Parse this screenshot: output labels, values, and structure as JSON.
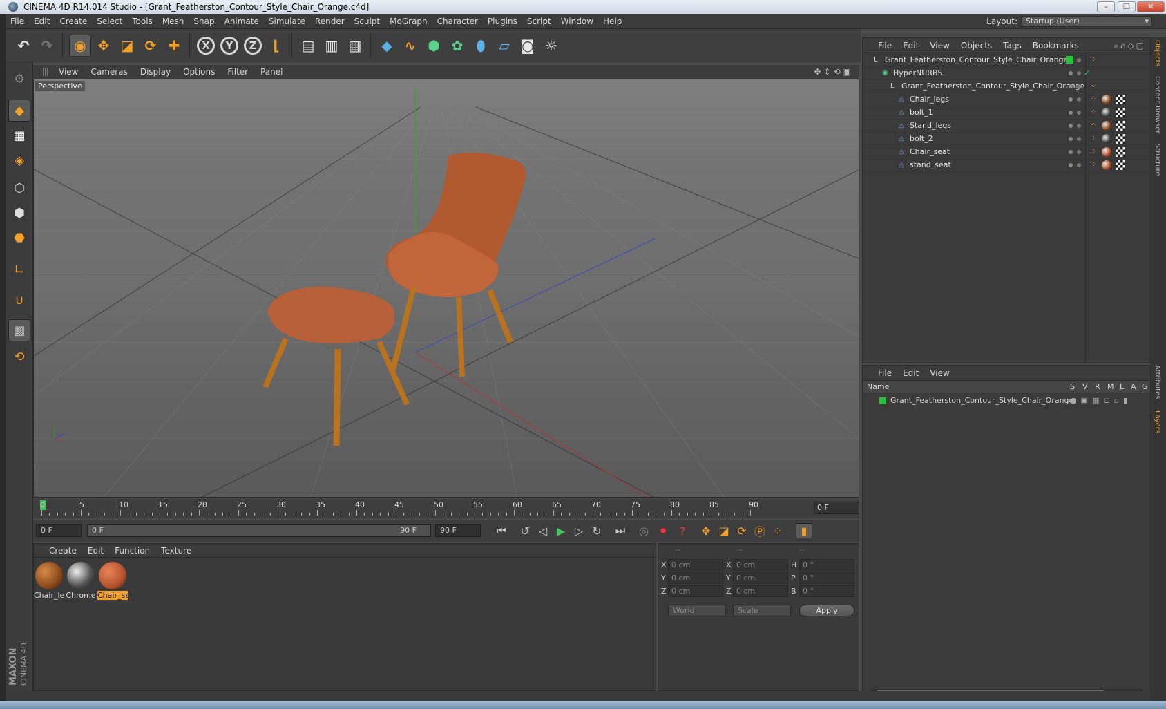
{
  "window": {
    "title": "CINEMA 4D R14.014 Studio - [Grant_Featherston_Contour_Style_Chair_Orange.c4d]",
    "controls": [
      "–",
      "❐",
      "✕"
    ]
  },
  "menubar": {
    "items": [
      "File",
      "Edit",
      "Create",
      "Select",
      "Tools",
      "Mesh",
      "Snap",
      "Animate",
      "Simulate",
      "Render",
      "Sculpt",
      "MoGraph",
      "Character",
      "Plugins",
      "Script",
      "Window",
      "Help"
    ],
    "layout_label": "Layout:",
    "layout_value": "Startup (User)"
  },
  "toolbar": {
    "icons": [
      "undo-icon",
      "redo-icon",
      "live-selection-icon",
      "move-icon",
      "scale-icon",
      "rotate-icon",
      "add-icon",
      "x-axis-icon",
      "y-axis-icon",
      "z-axis-icon",
      "world-coordinates-icon",
      "render-view-icon",
      "render-picture-viewer-icon",
      "edit-render-settings-icon",
      "cube-icon",
      "spline-icon",
      "nurbs-icon",
      "array-icon",
      "deformer-icon",
      "floor-icon",
      "camera-icon",
      "light-icon"
    ],
    "axis_labels": [
      "X",
      "Y",
      "Z"
    ]
  },
  "viewport": {
    "menu": [
      "View",
      "Cameras",
      "Display",
      "Options",
      "Filter",
      "Panel"
    ],
    "label": "Perspective"
  },
  "timeline": {
    "ticks": [
      "0",
      "5",
      "10",
      "15",
      "20",
      "25",
      "30",
      "35",
      "40",
      "45",
      "50",
      "55",
      "60",
      "65",
      "70",
      "75",
      "80",
      "85",
      "90"
    ],
    "current_frame_display": "0 F"
  },
  "transport": {
    "start_field": "0 F",
    "range_start": "0 F",
    "range_end": "90 F",
    "end_field": "90 F"
  },
  "materials": {
    "menu": [
      "Create",
      "Edit",
      "Function",
      "Texture"
    ],
    "items": [
      {
        "name": "Chair_le",
        "color": "#8a4a1c",
        "selected": false
      },
      {
        "name": "Chrome",
        "color": "#555555",
        "selected": false
      },
      {
        "name": "Chair_se",
        "color": "#b5532e",
        "selected": true
      }
    ]
  },
  "coordinates": {
    "headers": [
      "--",
      "--",
      "--"
    ],
    "rows": [
      {
        "a": "X",
        "av": "0 cm",
        "b": "X",
        "bv": "0 cm",
        "c": "H",
        "cv": "0 °"
      },
      {
        "a": "Y",
        "av": "0 cm",
        "b": "Y",
        "bv": "0 cm",
        "c": "P",
        "cv": "0 °"
      },
      {
        "a": "Z",
        "av": "0 cm",
        "b": "Z",
        "bv": "0 cm",
        "c": "B",
        "cv": "0 °"
      }
    ],
    "mode_dropdown": "World",
    "size_dropdown": "Scale",
    "apply_label": "Apply"
  },
  "objects_panel": {
    "menu": [
      "File",
      "Edit",
      "View",
      "Objects",
      "Tags",
      "Bookmarks"
    ],
    "rows": [
      {
        "name": "Grant_Featherston_Contour_Style_Chair_Orange",
        "type": "null",
        "indent": 0
      },
      {
        "name": "HyperNURBS",
        "type": "nurbs",
        "indent": 1
      },
      {
        "name": "Grant_Featherston_Contour_Style_Chair_Orange",
        "type": "null",
        "indent": 2
      },
      {
        "name": "Chair_legs",
        "type": "poly",
        "indent": 3,
        "mat": "#8a4a1c"
      },
      {
        "name": "bolt_1",
        "type": "poly",
        "indent": 3,
        "mat": "#444444"
      },
      {
        "name": "Stand_legs",
        "type": "poly",
        "indent": 3,
        "mat": "#8a4a1c"
      },
      {
        "name": "bolt_2",
        "type": "poly",
        "indent": 3,
        "mat": "#444444"
      },
      {
        "name": "Chair_seat",
        "type": "poly",
        "indent": 3,
        "mat": "#b5532e"
      },
      {
        "name": "stand_seat",
        "type": "poly",
        "indent": 3,
        "mat": "#b5532e"
      }
    ]
  },
  "layers_panel": {
    "menu": [
      "File",
      "Edit",
      "View"
    ],
    "columns": [
      "Name",
      "S",
      "V",
      "R",
      "M",
      "L",
      "A",
      "G"
    ],
    "rows": [
      {
        "name": "Grant_Featherston_Contour_Style_Chair_Orange",
        "color": "#27c43a"
      }
    ]
  },
  "side_tabs": [
    "Objects",
    "Content Browser",
    "Structure",
    "Attributes",
    "Layers"
  ],
  "brand": {
    "line1": "MAXON",
    "line2": "CINEMA 4D"
  },
  "colors": {
    "accent": "#f3a12a",
    "play_green": "#3fc85a",
    "layer_green": "#27c43a"
  }
}
